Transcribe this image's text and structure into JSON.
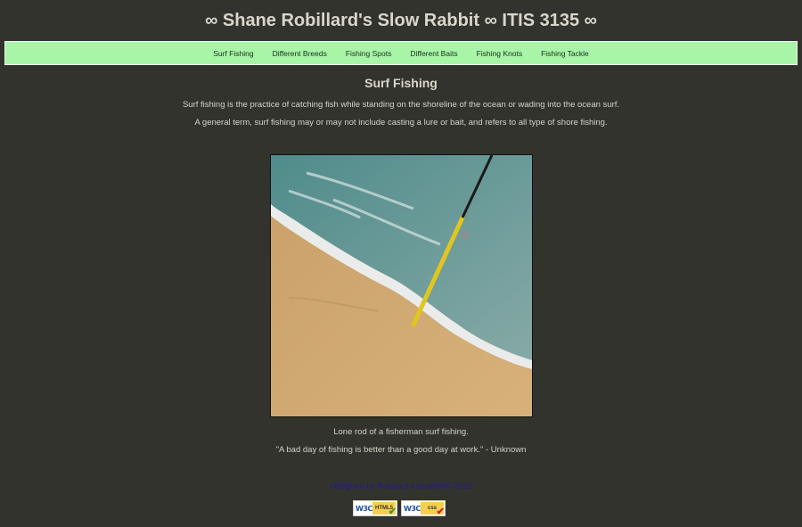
{
  "header": {
    "title": "∞ Shane Robillard's Slow Rabbit ∞ ITIS 3135 ∞"
  },
  "nav": {
    "items": [
      {
        "label": "Surf Fishing"
      },
      {
        "label": "Different Breeds"
      },
      {
        "label": "Fishing Spots"
      },
      {
        "label": "Different Baits"
      },
      {
        "label": "Fishing Knots"
      },
      {
        "label": "Fishing Tackle"
      }
    ]
  },
  "main": {
    "heading": "Surf Fishing",
    "paragraphs": [
      "Surf fishing is the practice of catching fish while standing on the shoreline of the ocean or wading into the ocean surf.",
      "A general term, surf fishing may or may not include casting a lure or bait, and refers to all type of shore fishing."
    ],
    "image_caption": "Lone rod of a fisherman surf fishing.",
    "quote": "\"A bad day of fishing is better than a good day at work.\" - Unknown"
  },
  "footer": {
    "designed_by": "Designed by Robillard Industries© 2022",
    "badges": [
      {
        "logo": "W3C",
        "tag": "HTML5",
        "icon": "html-validator-badge"
      },
      {
        "logo": "W3C",
        "tag": "css",
        "icon": "css-validator-badge"
      }
    ]
  },
  "colors": {
    "background": "#33332d",
    "nav_background": "#a8f5a8",
    "text": "#d3d3c8",
    "footer_link": "#1d1d8a"
  }
}
